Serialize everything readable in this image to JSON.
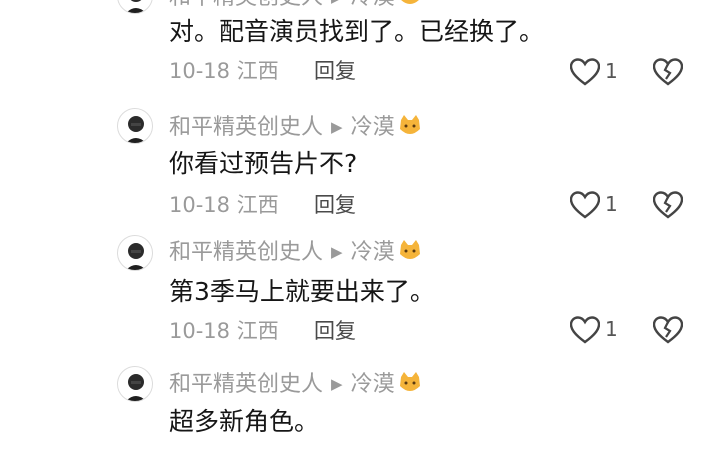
{
  "replies": [
    {
      "author": "和平精英创史人",
      "target": "冷漠",
      "text": "对。配音演员找到了。已经换了。",
      "date": "10-18",
      "location": "江西",
      "reply_label": "回复",
      "likes": "1"
    },
    {
      "author": "和平精英创史人",
      "target": "冷漠",
      "text": "你看过预告片不?",
      "date": "10-18",
      "location": "江西",
      "reply_label": "回复",
      "likes": "1"
    },
    {
      "author": "和平精英创史人",
      "target": "冷漠",
      "text": "第3季马上就要出来了。",
      "date": "10-18",
      "location": "江西",
      "reply_label": "回复",
      "likes": "1"
    },
    {
      "author": "和平精英创史人",
      "target": "冷漠",
      "text": "超多新角色。",
      "date": "",
      "location": "",
      "reply_label": "",
      "likes": ""
    }
  ],
  "icons": {
    "arrow": "play-arrow-icon",
    "target_emoji": "cat-face-emoji",
    "like": "heart-outline-icon",
    "dislike": "broken-heart-icon"
  },
  "colors": {
    "muted": "#9a9a9a",
    "text": "#161616",
    "reply_button": "#4a4a4a"
  }
}
